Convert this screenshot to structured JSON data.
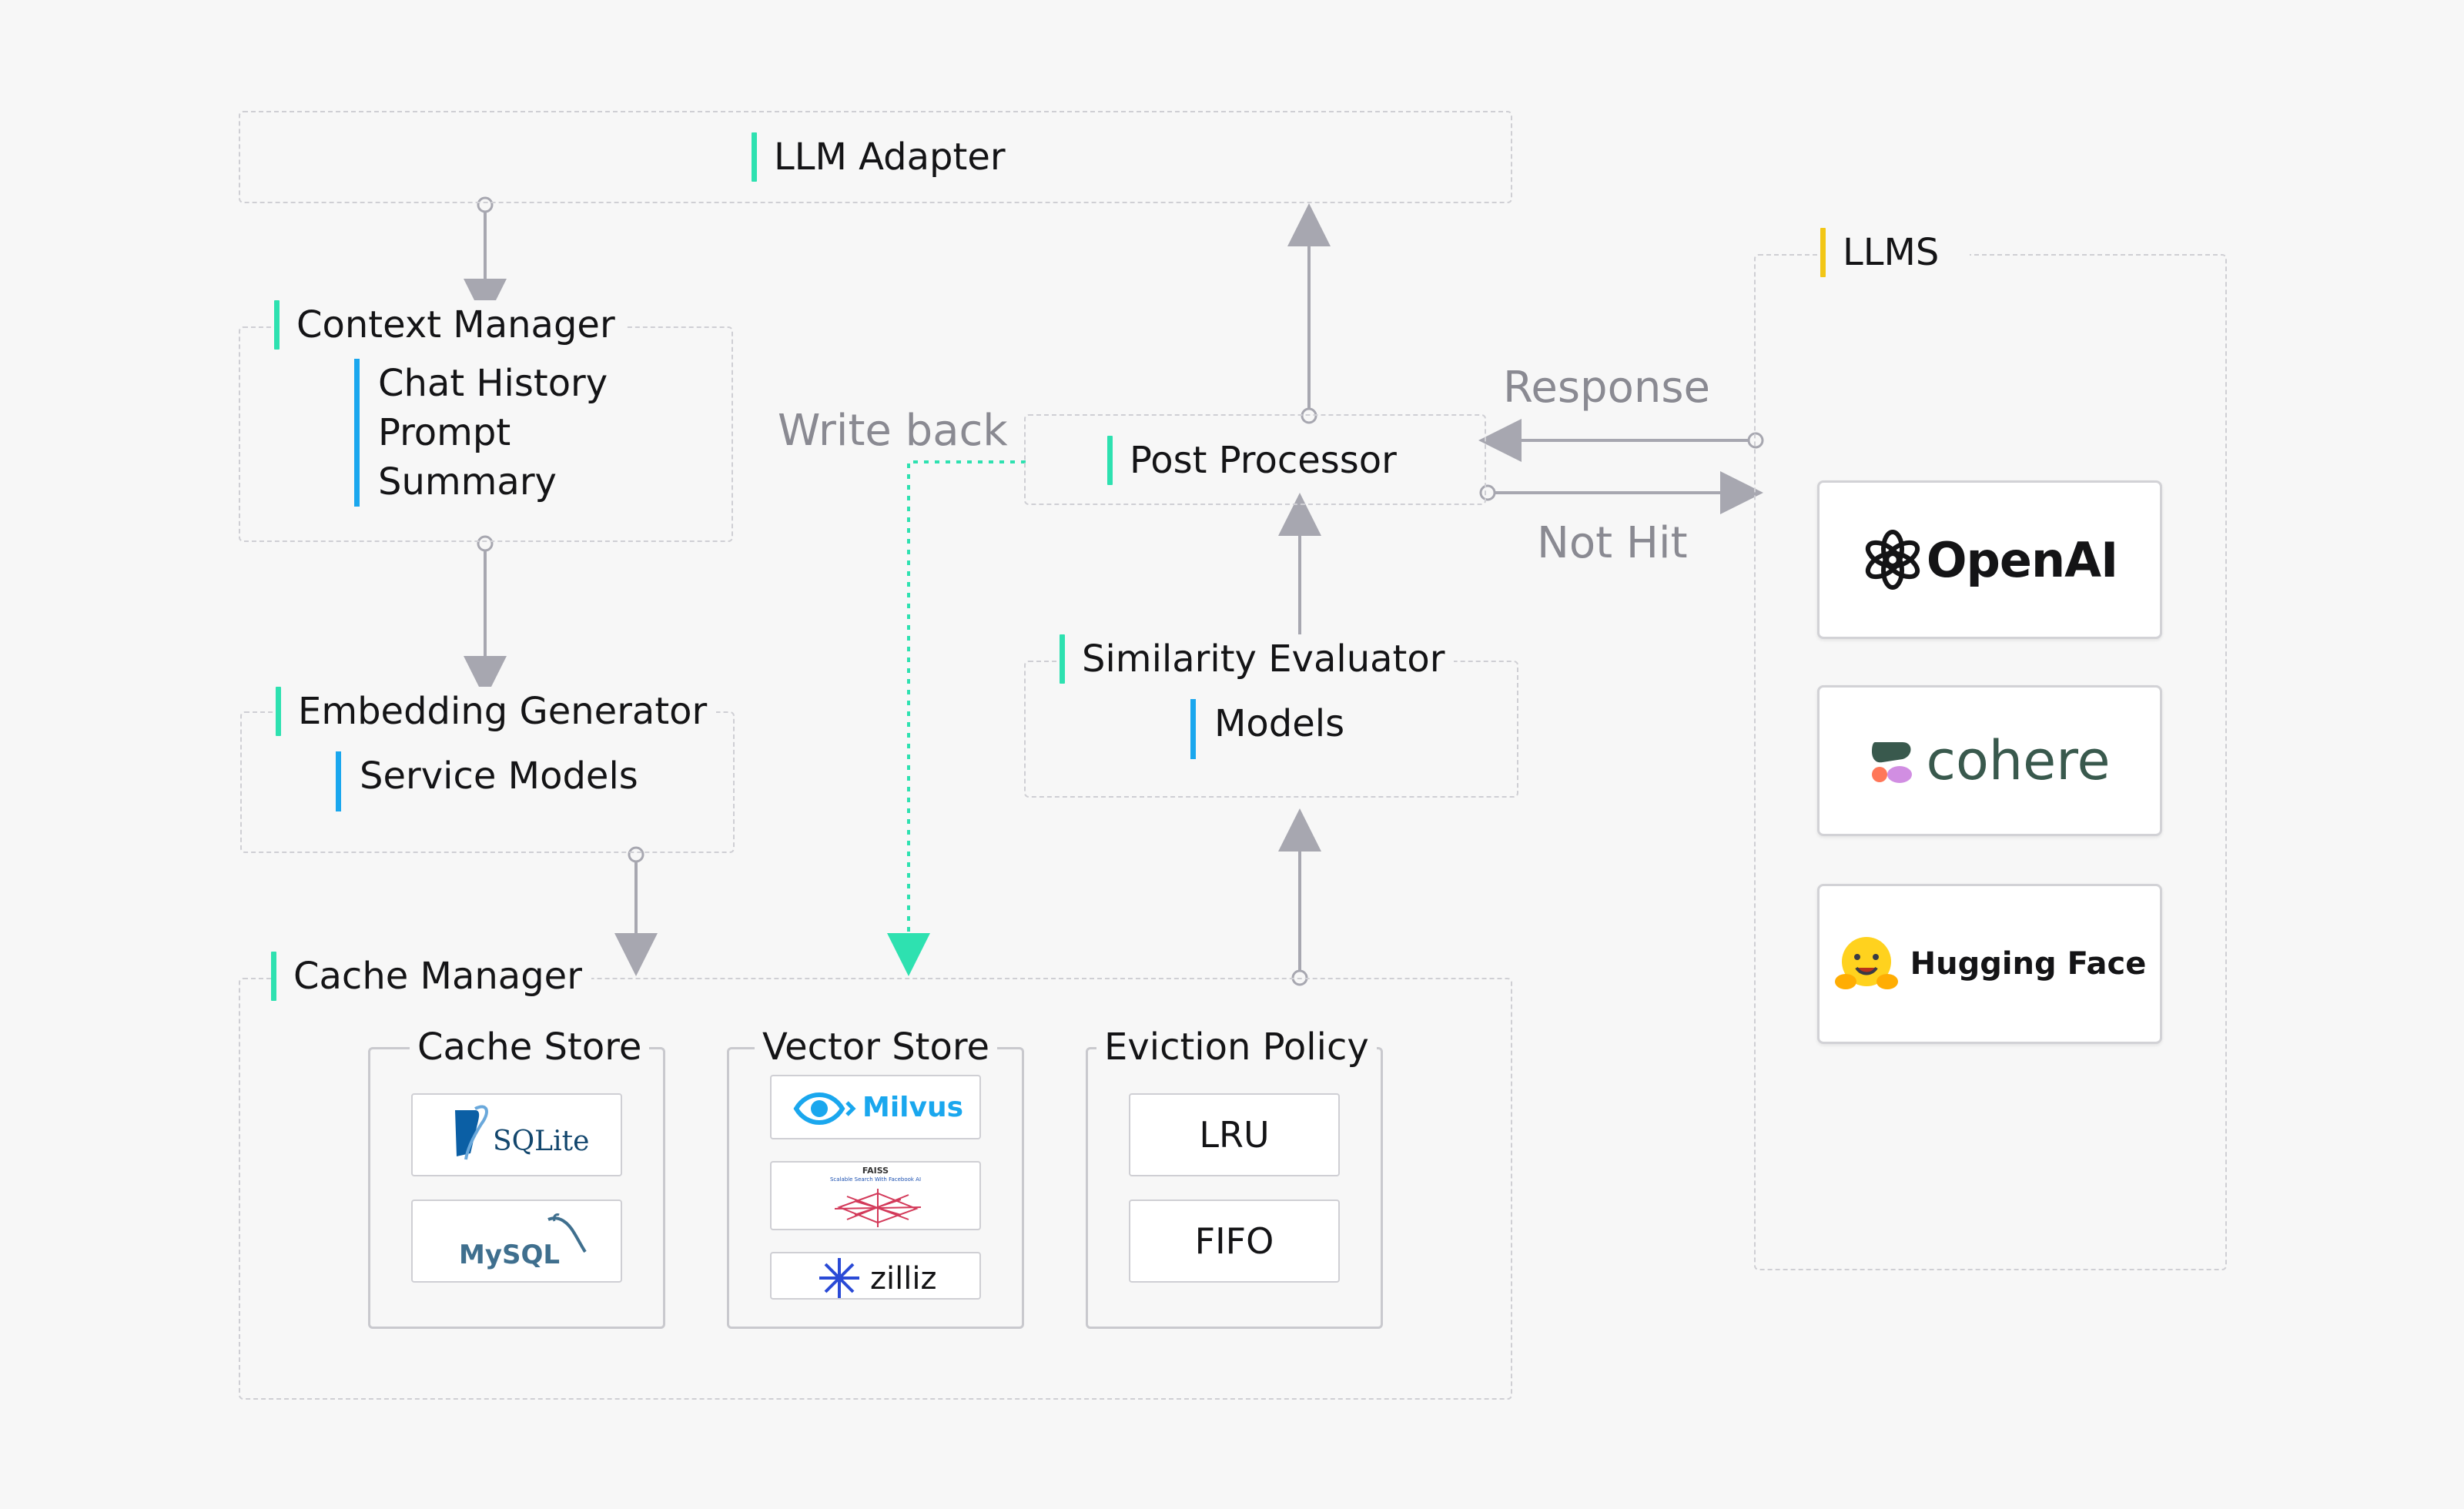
{
  "llm_adapter": {
    "title": "LLM Adapter"
  },
  "context_manager": {
    "title": "Context Manager",
    "items": [
      "Chat  History",
      "Prompt",
      "Summary"
    ]
  },
  "embedding_generator": {
    "title": "Embedding Generator",
    "items": [
      "Service Models"
    ]
  },
  "cache_manager": {
    "title": "Cache Manager",
    "cache_store": {
      "title": "Cache Store",
      "tiles": [
        "SQLite",
        "MySQL"
      ]
    },
    "vector_store": {
      "title": "Vector Store",
      "tiles": [
        "Milvus",
        "FAISS",
        "Scalable Search With Facebook AI",
        "zilliz"
      ]
    },
    "eviction_policy": {
      "title": "Eviction Policy",
      "tiles": [
        "LRU",
        "FIFO"
      ]
    }
  },
  "post_processor": {
    "title": "Post Processor"
  },
  "similarity_evaluator": {
    "title": "Similarity Evaluator",
    "items": [
      "Models"
    ]
  },
  "llms": {
    "title": "LLMS",
    "providers": [
      "OpenAI",
      "cohere",
      "Hugging Face"
    ]
  },
  "edge_labels": {
    "write_back": "Write back",
    "response": "Response",
    "not_hit": "Not Hit"
  },
  "colors": {
    "accent_green": "#2ee1b0",
    "accent_blue": "#1aa7ee",
    "accent_yellow": "#f2c616",
    "connector": "#a7a7b0",
    "write_back_line": "#2ee1b0"
  }
}
